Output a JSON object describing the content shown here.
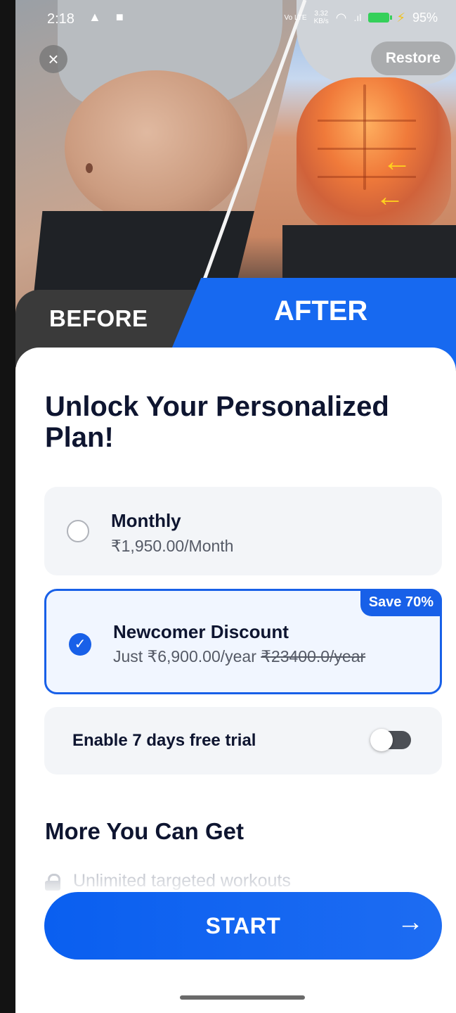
{
  "status_bar": {
    "time": "2:18",
    "left_icons": "▲ ■",
    "net_speed_top": "3.32",
    "net_speed_bottom": "KB/s",
    "battery_percent": "95%"
  },
  "header": {
    "close_icon": "×",
    "restore_label": "Restore"
  },
  "banner": {
    "before_label": "BEFORE",
    "after_label": "AFTER"
  },
  "headline": "Unlock Your Personalized Plan!",
  "plans": [
    {
      "title": "Monthly",
      "price": "₹1,950.00/Month",
      "selected": false
    },
    {
      "title": "Newcomer Discount",
      "price_prefix": "Just ₹6,900.00/year",
      "price_original": "₹23400.0/year",
      "badge": "Save 70%",
      "selected": true
    }
  ],
  "trial": {
    "label": "Enable 7 days free trial",
    "enabled": false
  },
  "more_section": {
    "title": "More You Can Get",
    "benefits": [
      "Unlimited targeted workouts"
    ]
  },
  "cta": {
    "label": "START",
    "arrow": "→"
  },
  "colors": {
    "accent": "#1860e8",
    "dark_text": "#0e1530",
    "before_tab": "#3a3a3a",
    "after_tab": "#1769f0"
  }
}
